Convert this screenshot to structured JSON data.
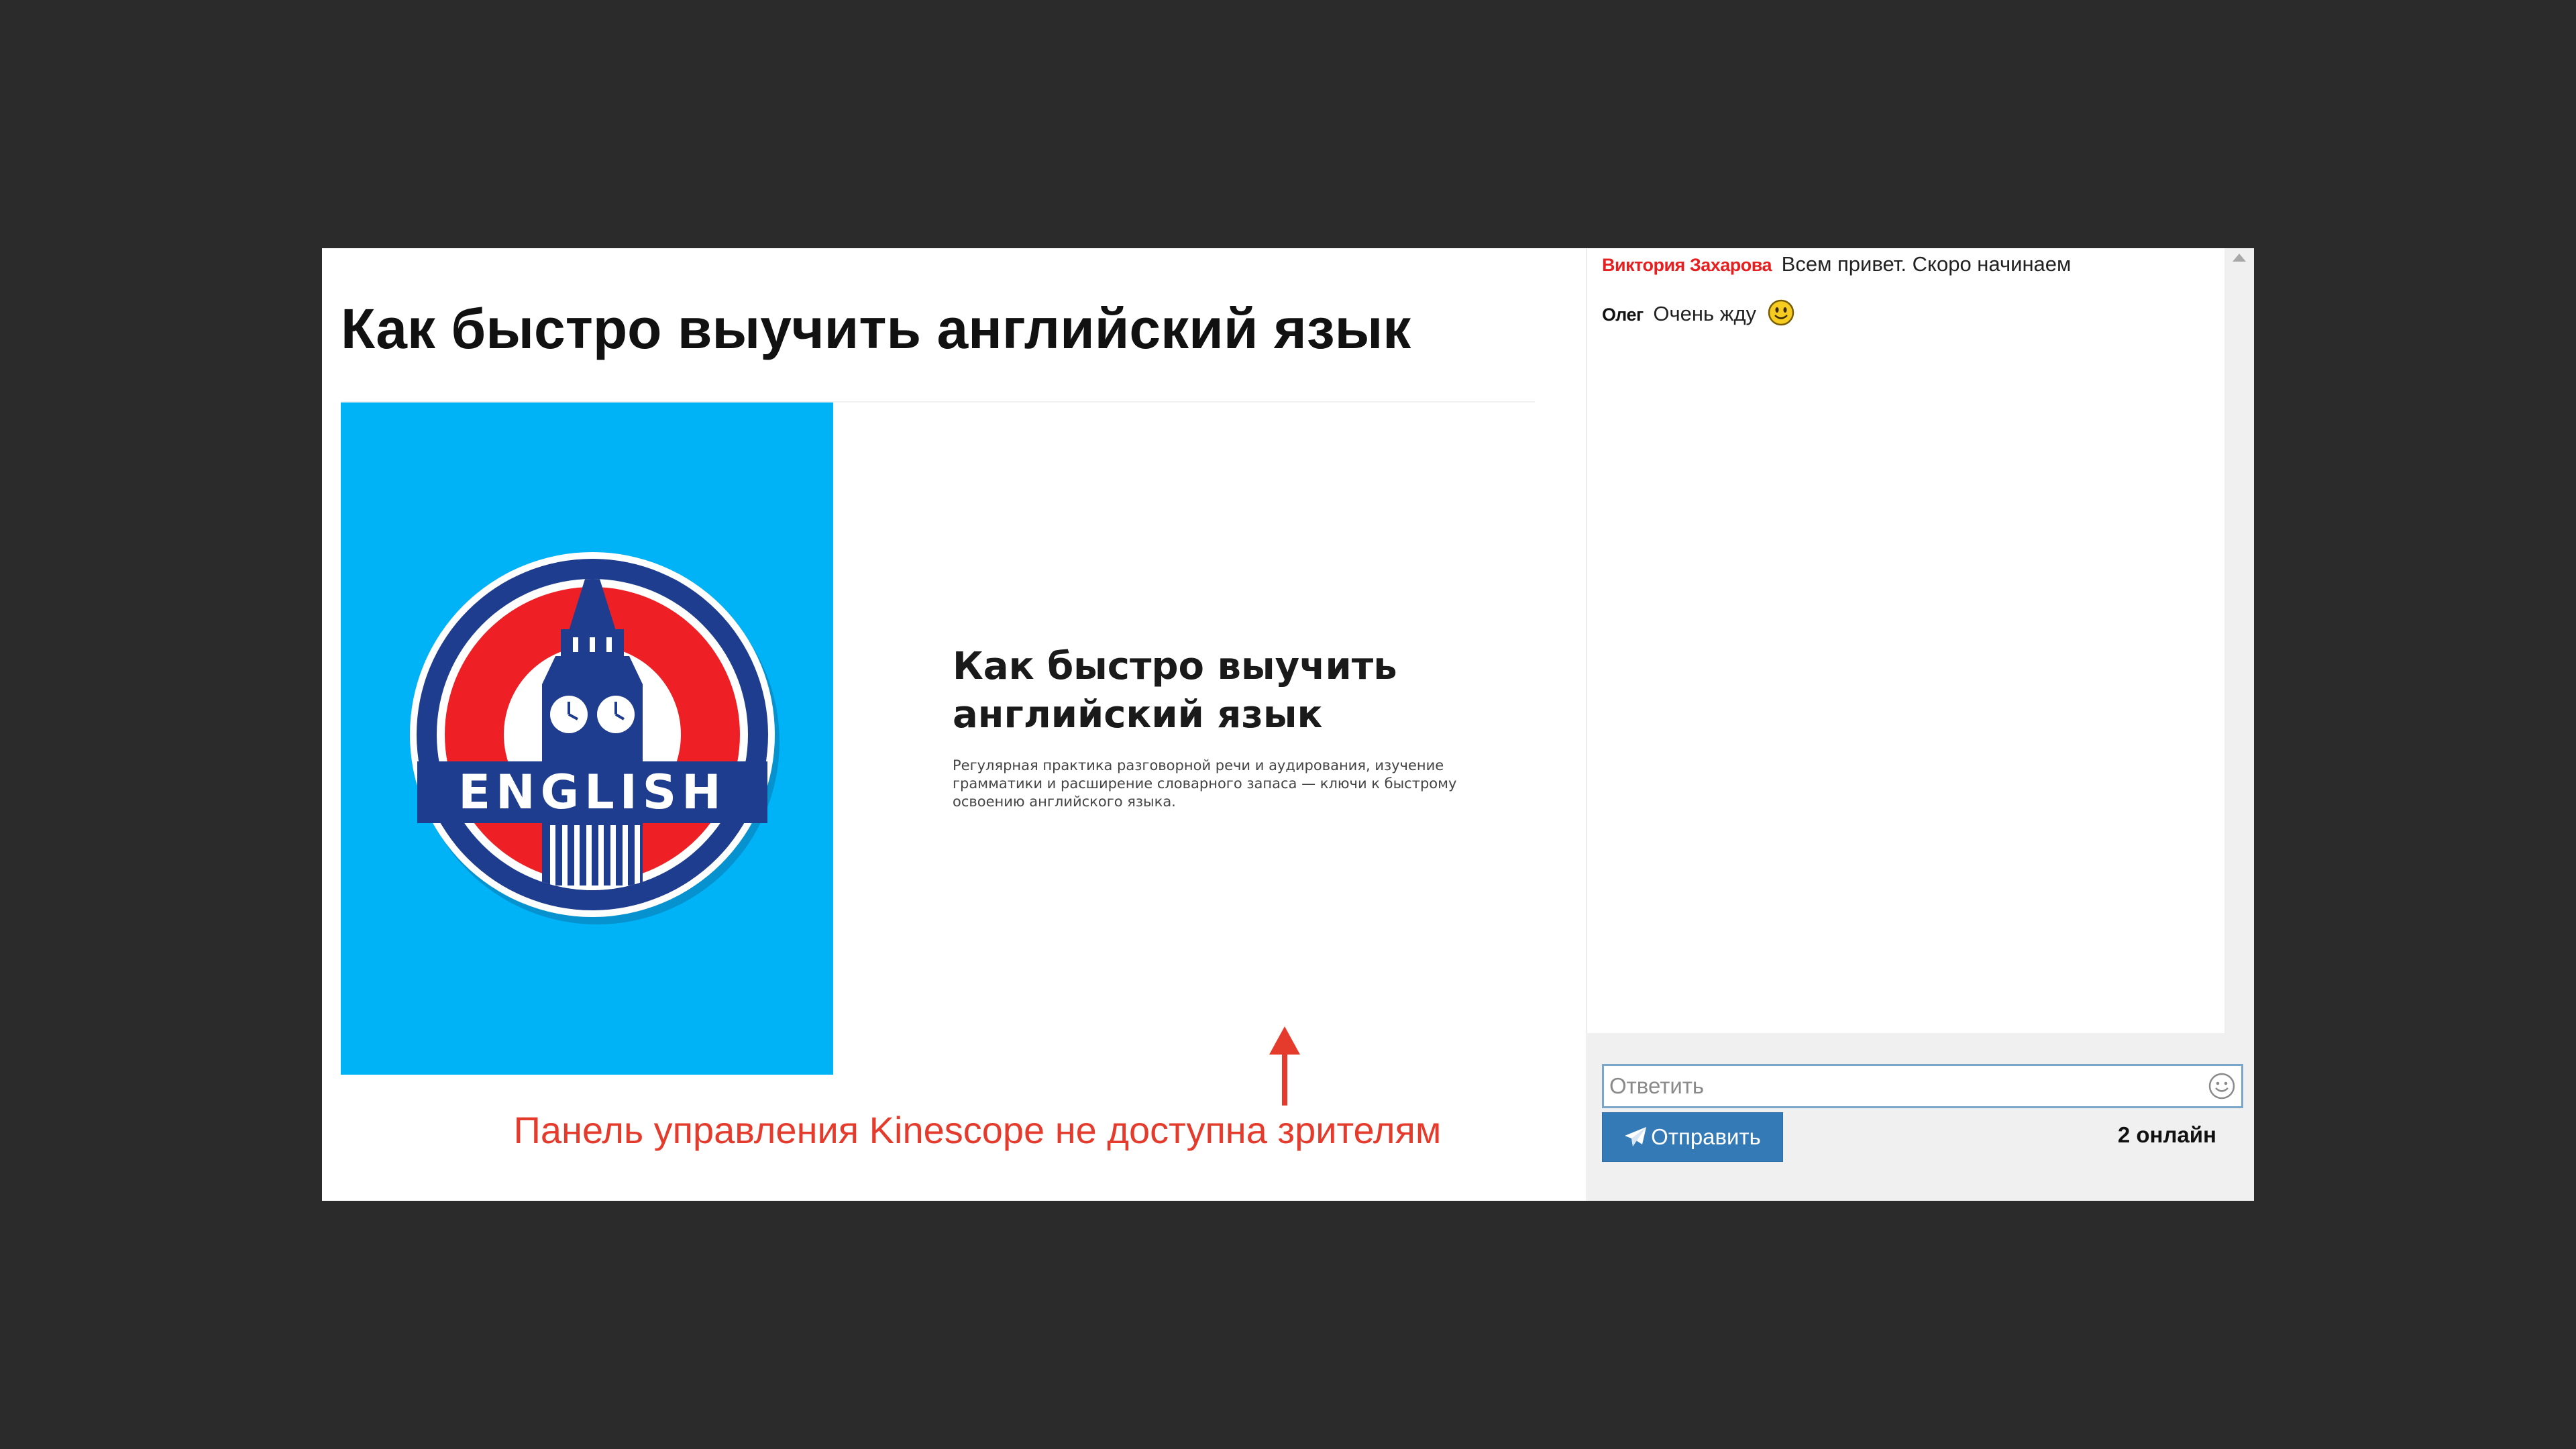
{
  "page": {
    "title": "Как быстро выучить английский язык"
  },
  "slide": {
    "logo_text": "ENGLISH",
    "title_line1": "Как быстро выучить",
    "title_line2": "английский язык",
    "description": "Регулярная практика разговорной речи и аудирования, изучение грамматики и расширение словарного запаса — ключи к быстрому освоению английского языка.",
    "background_color": "#00b2f6"
  },
  "annotation": {
    "text": "Панель управления Kinescope не доступна зрителям",
    "color": "#e53b2c"
  },
  "chat": {
    "messages": [
      {
        "author": "Виктория Захарова",
        "text": "Всем привет. Скоро начинаем",
        "author_color": "#e62020"
      },
      {
        "author": "Олег",
        "text": "Очень жду",
        "emoji": "smiley-icon"
      }
    ],
    "reply_placeholder": "Ответить",
    "send_label": "Отправить",
    "online": "2 онлайн",
    "accent_color": "#337ab7"
  }
}
